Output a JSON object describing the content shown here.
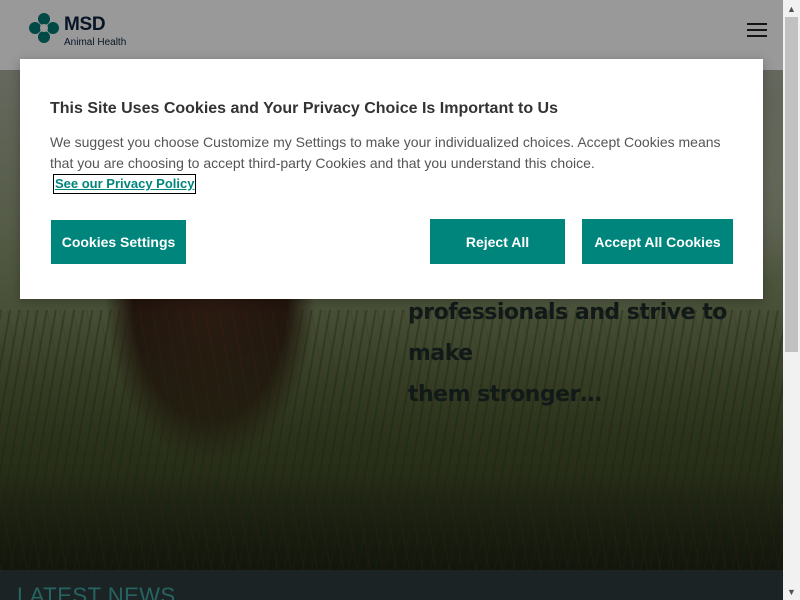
{
  "header": {
    "logo_name": "MSD",
    "logo_subtitle": "Animal Health",
    "brand_color": "#007a73",
    "menu_icon": "hamburger-menu-icon"
  },
  "hero": {
    "text_line_1": "professionals and strive to make",
    "text_line_2": "them stronger…"
  },
  "news": {
    "title": "LATEST NEWS"
  },
  "cookie_banner": {
    "title": "This Site Uses Cookies and Your Privacy Choice Is Important to Us",
    "description": "We suggest you choose Customize my Settings to make your individualized choices. Accept Cookies means that you are choosing to accept third-party Cookies and that you understand this choice.",
    "privacy_link": "See our Privacy Policy",
    "settings_button": "Cookies Settings",
    "reject_button": "Reject All",
    "accept_button": "Accept All Cookies",
    "button_color": "#00857c"
  },
  "scrollbar": {
    "up_icon": "scroll-up-arrow-icon",
    "down_icon": "scroll-down-arrow-icon"
  }
}
